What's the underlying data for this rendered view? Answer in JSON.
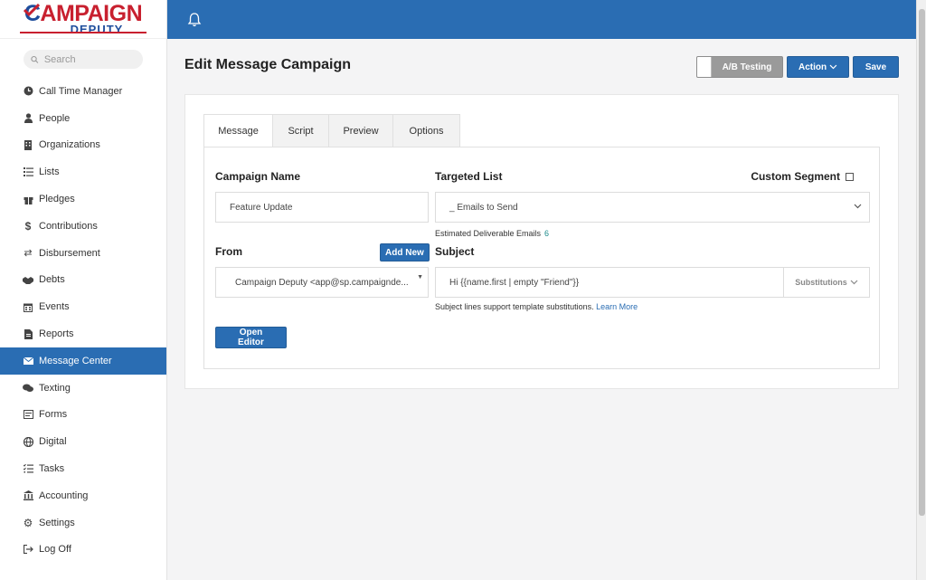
{
  "brand": {
    "line1_first": "C",
    "line1_rest": "AMPAIGN",
    "line2": "DEPUTY"
  },
  "search": {
    "placeholder": "Search"
  },
  "nav": [
    {
      "label": "Call Time Manager",
      "icon": "clock-icon",
      "active": false
    },
    {
      "label": "People",
      "icon": "person-icon",
      "active": false
    },
    {
      "label": "Organizations",
      "icon": "building-icon",
      "active": false
    },
    {
      "label": "Lists",
      "icon": "list-icon",
      "active": false
    },
    {
      "label": "Pledges",
      "icon": "gift-icon",
      "active": false
    },
    {
      "label": "Contributions",
      "icon": "dollar-icon",
      "active": false
    },
    {
      "label": "Disbursement",
      "icon": "exchange-icon",
      "active": false
    },
    {
      "label": "Debts",
      "icon": "handshake-icon",
      "active": false
    },
    {
      "label": "Events",
      "icon": "calendar-icon",
      "active": false
    },
    {
      "label": "Reports",
      "icon": "document-icon",
      "active": false
    },
    {
      "label": "Message Center",
      "icon": "envelope-icon",
      "active": true
    },
    {
      "label": "Texting",
      "icon": "chat-icon",
      "active": false
    },
    {
      "label": "Forms",
      "icon": "form-icon",
      "active": false
    },
    {
      "label": "Digital",
      "icon": "globe-icon",
      "active": false
    },
    {
      "label": "Tasks",
      "icon": "tasks-icon",
      "active": false
    },
    {
      "label": "Accounting",
      "icon": "bank-icon",
      "active": false
    },
    {
      "label": "Settings",
      "icon": "gear-icon",
      "active": false
    },
    {
      "label": "Log Off",
      "icon": "logout-icon",
      "active": false
    }
  ],
  "page": {
    "title": "Edit Message Campaign"
  },
  "actions": {
    "ab_label": "A/B Testing",
    "action_label": "Action",
    "save_label": "Save"
  },
  "tabs": [
    "Message",
    "Script",
    "Preview",
    "Options"
  ],
  "form": {
    "campaign_name_label": "Campaign Name",
    "campaign_name_value": "Feature Update",
    "targeted_list_label": "Targeted List",
    "targeted_list_value": "_ Emails to Send",
    "custom_segment_label": "Custom Segment",
    "estimated_label": "Estimated Deliverable Emails",
    "estimated_value": "6",
    "from_label": "From",
    "add_new_label": "Add New",
    "from_value": "Campaign Deputy <app@sp.campaignde...",
    "subject_label": "Subject",
    "subject_value": "Hi {{name.first | empty \"Friend\"}}",
    "substitutions_label": "Substitutions",
    "subject_note": "Subject lines support template substitutions.",
    "learn_more": "Learn More",
    "open_editor_label": "Open Editor"
  },
  "colors": {
    "primary": "#2a6db3",
    "brand_red": "#c8202f",
    "brand_blue": "#1f4e9c"
  }
}
